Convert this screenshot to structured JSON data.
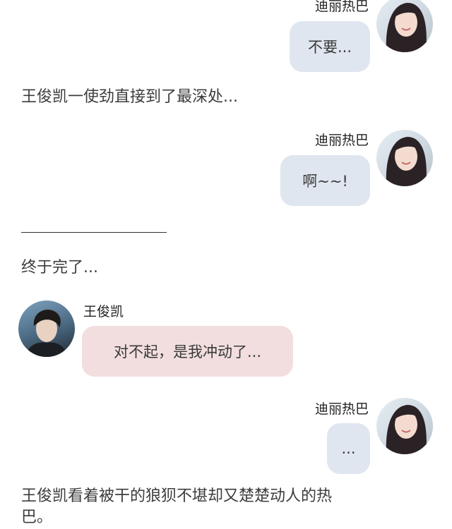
{
  "messages": [
    {
      "sender": "迪丽热巴",
      "text": "不要..."
    },
    {
      "sender": "迪丽热巴",
      "text": "啊~~!"
    },
    {
      "sender": "王俊凯",
      "text": "对不起，是我冲动了..."
    },
    {
      "sender": "迪丽热巴",
      "text": "..."
    }
  ],
  "narration": [
    "王俊凯一使劲直接到了最深处...",
    "终于完了...",
    "王俊凯看着被干的狼狈不堪却又楚楚动人的热",
    "巴。"
  ],
  "colors": {
    "right_bubble": "#dfe6ef",
    "left_bubble": "#f2dede",
    "background": "#ffffff"
  }
}
